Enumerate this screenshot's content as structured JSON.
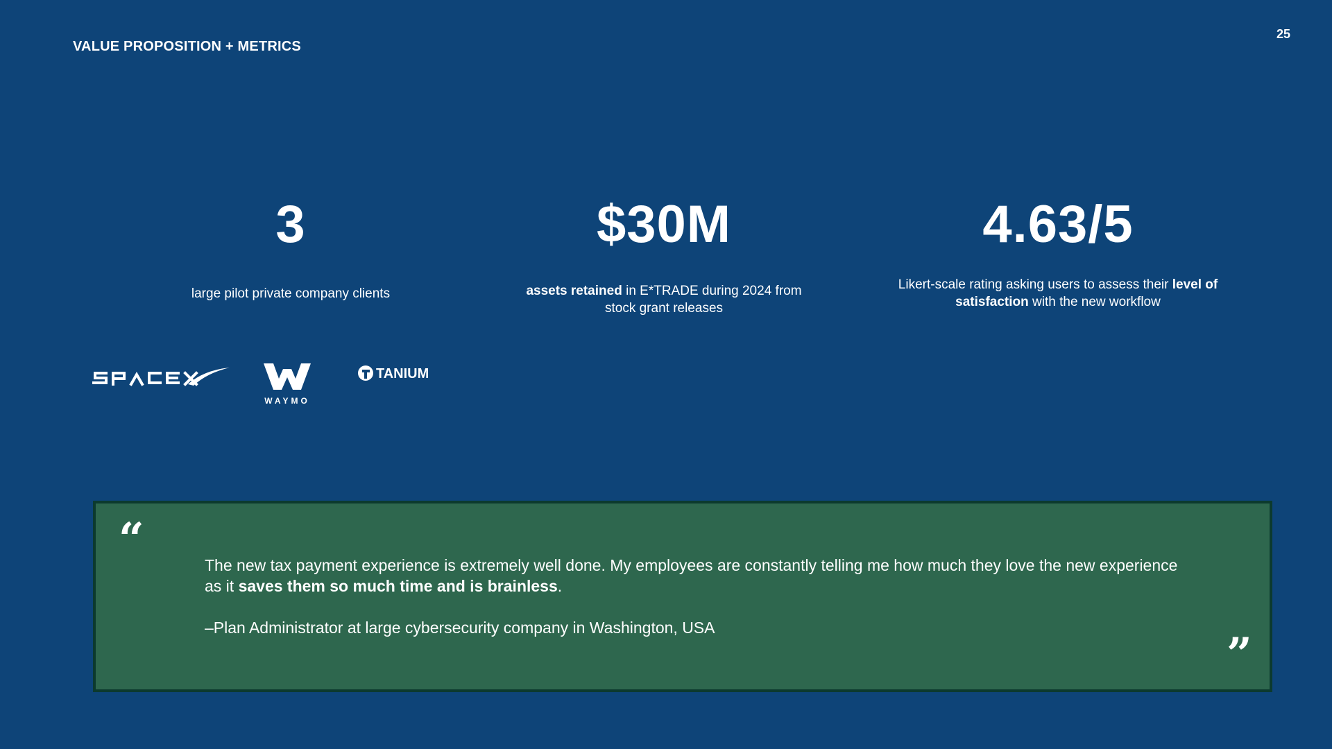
{
  "header": {
    "section_title": "VALUE PROPOSITION + METRICS",
    "page_number": "25"
  },
  "metrics": [
    {
      "value": "3",
      "desc_plain": "large pilot private company clients"
    },
    {
      "value": "$30M",
      "desc_bold": "assets retained",
      "desc_rest": " in E*TRADE during 2024 from stock grant releases"
    },
    {
      "value": "4.63/5",
      "desc_pre": "Likert-scale rating asking users to assess their ",
      "desc_bold": "level of satisfaction",
      "desc_post": " with the new workflow"
    }
  ],
  "logos": {
    "spacex": "SPACEX",
    "waymo": "WAYMO",
    "tanium": "TANIUM"
  },
  "quote": {
    "open_mark": "“",
    "close_mark": "”",
    "text_pre": "The new tax payment experience is extremely well done. My employees are constantly telling me how much they love the new experience as it ",
    "text_bold": "saves them so much time and is brainless",
    "text_post": ".",
    "attribution": "–Plan Administrator at large cybersecurity company in Washington, USA"
  },
  "colors": {
    "background": "#0e4478",
    "quote_box": "#2e674e",
    "quote_border": "#0c3a2e",
    "text": "#ffffff"
  }
}
